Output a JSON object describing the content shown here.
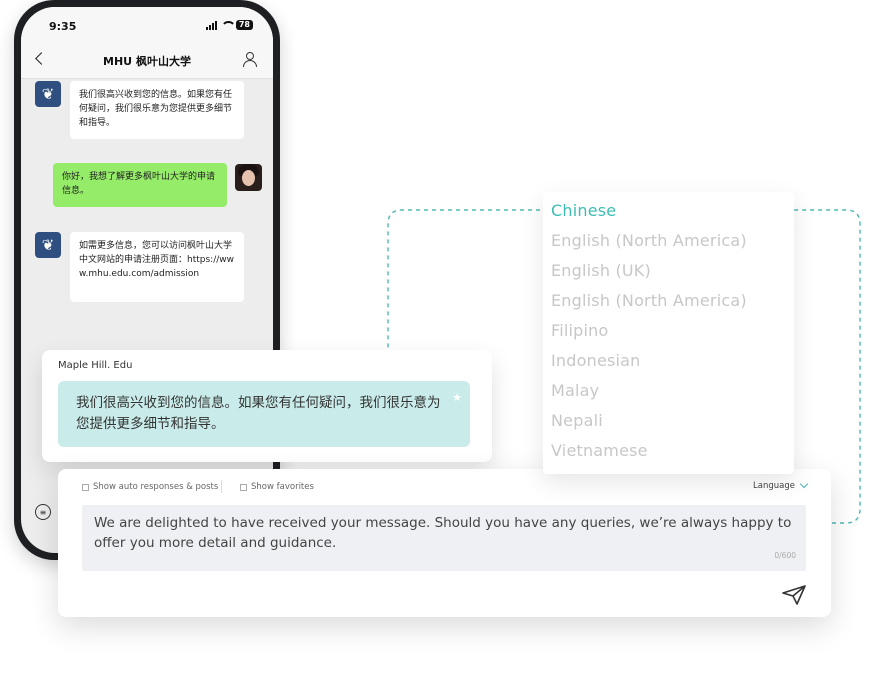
{
  "phone": {
    "status": {
      "time": "9:35",
      "battery": "78"
    },
    "title": "MHU 枫叶山大学",
    "messages": [
      {
        "from": "university",
        "text": "我们很高兴收到您的信息。如果您有任何疑问，我们很乐意为您提供更多细节和指导。"
      },
      {
        "from": "user",
        "text": "你好，我想了解更多枫叶山大学的申请信息。"
      },
      {
        "from": "university",
        "text": "如需更多信息，您可以访问枫叶山大学中文网站的申请注册页面：https://www.mhu.edu.com/admission"
      }
    ]
  },
  "translated": {
    "sender": "Maple Hill. Edu",
    "text": "我们很高兴收到您的信息。如果您有任何疑问，我们很乐意为您提供更多细节和指导。"
  },
  "composer": {
    "show_auto": "Show auto responses & posts",
    "show_favorites": "Show favorites",
    "language_label": "Language",
    "message": "We are delighted to have received your message. Should you have any queries, we’re always happy to offer you more detail and guidance.",
    "counter": "0/600"
  },
  "languages": {
    "selected": "Chinese",
    "items": [
      "Chinese",
      "English (North America)",
      "English (UK)",
      "English (North America)",
      "Filipino",
      "Indonesian",
      "Malay",
      "Nepali",
      "Vietnamese"
    ]
  },
  "colors": {
    "accent": "#3dbdb3",
    "bubble_green": "#95ec69",
    "translation_bubble": "#c9ecea",
    "uni_avatar": "#2e4f80"
  }
}
